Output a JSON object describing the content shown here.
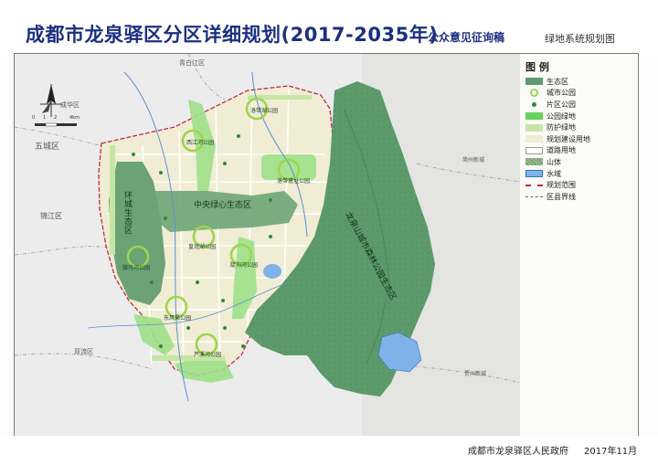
{
  "header": {
    "title": "成都市龙泉驿区分区详细规划(2017-2035年)",
    "subtitle": "公众意见征询稿",
    "sheet_name": "绿地系统规划图"
  },
  "legend": {
    "title": "图 例",
    "items": [
      {
        "label": "生态区",
        "color": "#5f9b6e",
        "style": "fill"
      },
      {
        "label": "城市公园",
        "color": "#9ed44f",
        "style": "ring"
      },
      {
        "label": "片区公园",
        "color": "#2f8a3c",
        "style": "dot"
      },
      {
        "label": "公园绿地",
        "color": "#66d35d",
        "style": "fill"
      },
      {
        "label": "防护绿地",
        "color": "#c6e6a6",
        "style": "fill"
      },
      {
        "label": "规划建设用地",
        "color": "#f0edd4",
        "style": "fill"
      },
      {
        "label": "道路用地",
        "color": "#ffffff",
        "style": "road"
      },
      {
        "label": "山体",
        "color": "#95b98e",
        "style": "hatch"
      },
      {
        "label": "水域",
        "color": "#7fb2e8",
        "style": "water"
      },
      {
        "label": "规划范围",
        "color": "#bd2a4a",
        "style": "boundary"
      },
      {
        "label": "区县界线",
        "color": "#666666",
        "style": "county"
      }
    ]
  },
  "map": {
    "scale_labels": [
      "0",
      "1",
      "2",
      "4km"
    ],
    "districts": [
      "青白江区",
      "成华区",
      "五城区",
      "锦江区",
      "双流区",
      "简州新城",
      "贾州新城"
    ],
    "zones": [
      "环城生态区",
      "中央绿心生态区",
      "龙泉山城市森林公园生态区"
    ],
    "parks": [
      "洛带湖公园",
      "西江河公园",
      "洛带遗址公园",
      "皇冠湖公园",
      "陡沟河公园",
      "驿马河公园",
      "东风渠公园",
      "芦溪河公园"
    ]
  },
  "footer": {
    "organization": "成都市龙泉驿区人民政府",
    "date": "2017年11月"
  }
}
